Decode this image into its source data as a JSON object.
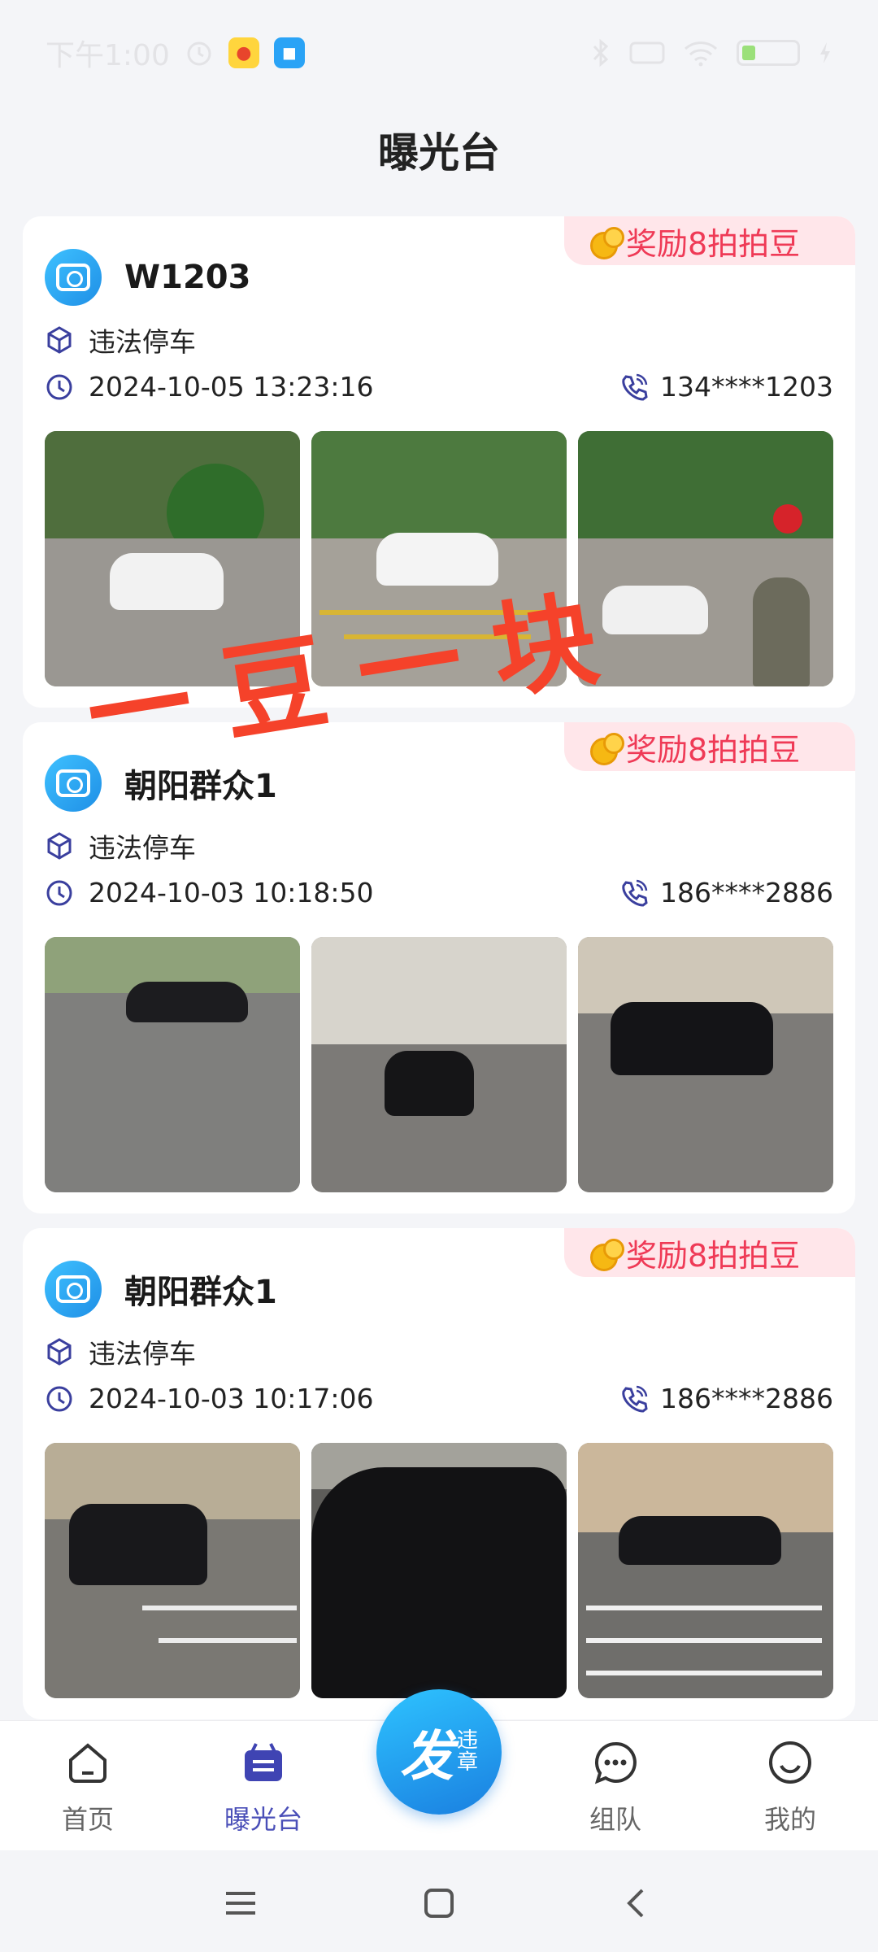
{
  "status_bar": {
    "time": "下午1:00",
    "battery_level": 0.25
  },
  "page_title": "曝光台",
  "reports": [
    {
      "name": "W1203",
      "reward": "奖励8拍拍豆",
      "violation": "违法停车",
      "datetime": "2024-10-05 13:23:16",
      "phone": "134****1203",
      "photo_count": 3
    },
    {
      "name": "朝阳群众1",
      "reward": "奖励8拍拍豆",
      "violation": "违法停车",
      "datetime": "2024-10-03 10:18:50",
      "phone": "186****2886",
      "photo_count": 3
    },
    {
      "name": "朝阳群众1",
      "reward": "奖励8拍拍豆",
      "violation": "违法停车",
      "datetime": "2024-10-03 10:17:06",
      "phone": "186****2886",
      "photo_count": 3
    }
  ],
  "watermark_text": "一豆一块",
  "tabbar": {
    "home": "首页",
    "exposure": "曝光台",
    "fab_main": "发",
    "fab_sub_1": "违",
    "fab_sub_2": "章",
    "team": "组队",
    "mine": "我的"
  },
  "colors": {
    "accent": "#4a4fb8",
    "reward_text": "#ef3a56",
    "reward_bg": "#ffe6ea",
    "fab_blue": "#1a7fe0",
    "watermark": "#f5422a"
  }
}
